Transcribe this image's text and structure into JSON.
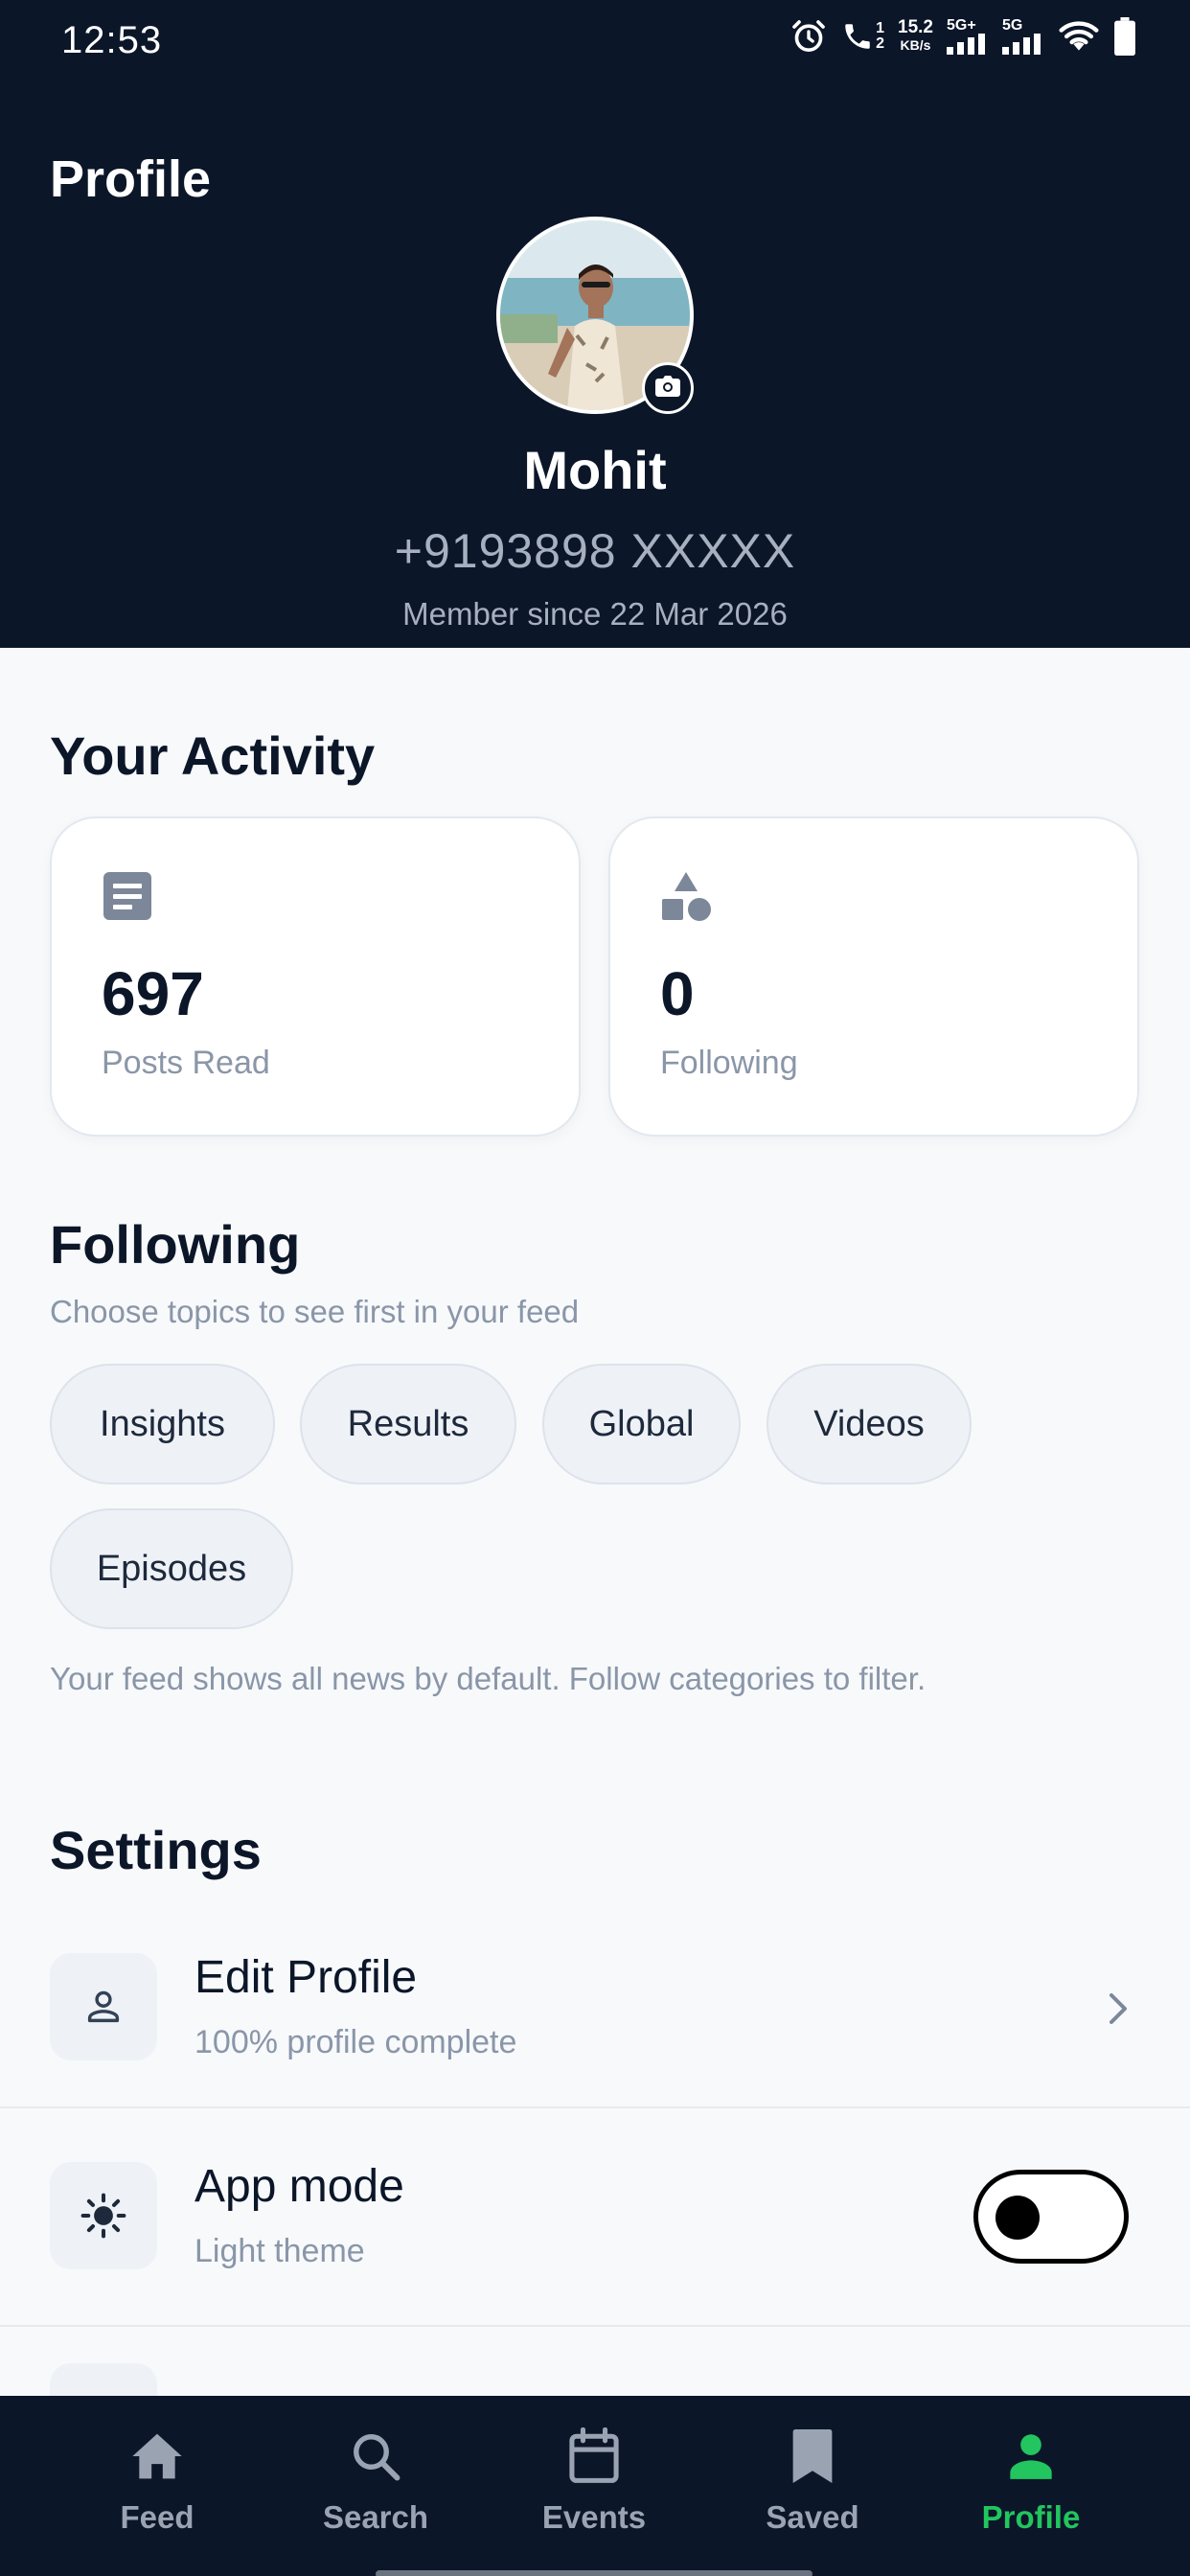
{
  "status_bar": {
    "time": "12:53",
    "network_speed_value": "15.2",
    "network_speed_unit": "KB/s",
    "sim1_label": "5G+",
    "sim2_label": "5G",
    "call_sim_top": "1",
    "call_sim_bottom": "2",
    "icons": [
      "alarm-icon",
      "wifi-call-icon",
      "signal-icon",
      "signal-icon",
      "wifi-icon",
      "battery-icon"
    ]
  },
  "header": {
    "title": "Profile",
    "name": "Mohit",
    "phone": "+9193898 XXXXX",
    "member_since": "Member since 22 Mar 2026"
  },
  "activity": {
    "title": "Your Activity",
    "cards": [
      {
        "icon": "article-icon",
        "value": "697",
        "label": "Posts Read"
      },
      {
        "icon": "shapes-icon",
        "value": "0",
        "label": "Following"
      }
    ]
  },
  "following": {
    "title": "Following",
    "subtitle": "Choose topics to see first in your feed",
    "chips": [
      "Insights",
      "Results",
      "Global",
      "Videos",
      "Episodes"
    ],
    "hint": "Your feed shows all news by default. Follow categories to filter."
  },
  "settings": {
    "title": "Settings",
    "items": [
      {
        "icon": "user-icon",
        "title": "Edit Profile",
        "subtitle": "100% profile complete"
      },
      {
        "icon": "sun-icon",
        "title": "App mode",
        "subtitle": "Light theme",
        "toggle_on": false
      }
    ]
  },
  "nav": {
    "items": [
      {
        "label": "Feed",
        "icon": "home-icon",
        "active": false
      },
      {
        "label": "Search",
        "icon": "search-icon",
        "active": false
      },
      {
        "label": "Events",
        "icon": "calendar-icon",
        "active": false
      },
      {
        "label": "Saved",
        "icon": "bookmark-icon",
        "active": false
      },
      {
        "label": "Profile",
        "icon": "person-icon",
        "active": true
      }
    ]
  },
  "colors": {
    "header_bg": "#0c1629",
    "accent": "#22c55e",
    "muted_text": "#8a96a8"
  }
}
